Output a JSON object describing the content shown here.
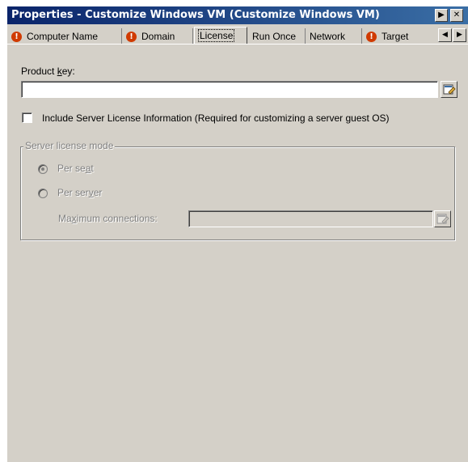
{
  "window": {
    "title": "Properties - Customize Windows VM (Customize Windows VM)",
    "help_glyph": "▶",
    "close_glyph": "✕"
  },
  "tabs": [
    {
      "label": "Computer Name",
      "warning": true,
      "active": false
    },
    {
      "label": "Domain",
      "warning": true,
      "active": false
    },
    {
      "label": "License",
      "warning": false,
      "active": true
    },
    {
      "label": "Run Once",
      "warning": false,
      "active": false
    },
    {
      "label": "Network",
      "warning": false,
      "active": false
    },
    {
      "label": "Target",
      "warning": true,
      "active": false
    }
  ],
  "tab_scroll": {
    "left": "◀",
    "right": "▶"
  },
  "warning_glyph": "!",
  "product_key": {
    "label_pre": "Product ",
    "label_u": "k",
    "label_post": "ey:",
    "value": "",
    "browse_icon": "edit-icon"
  },
  "include_license": {
    "checked": false,
    "label": "Include Server License Information (Required for customizing a server guest OS)"
  },
  "server_license_mode": {
    "group_label": "Server license mode",
    "per_seat": {
      "pre": "Per se",
      "u": "a",
      "post": "t",
      "selected": true
    },
    "per_server": {
      "pre": "Per ser",
      "u": "v",
      "post": "er",
      "selected": false
    },
    "max_connections": {
      "pre": "Ma",
      "u": "x",
      "post": "imum connections:",
      "value": ""
    }
  }
}
